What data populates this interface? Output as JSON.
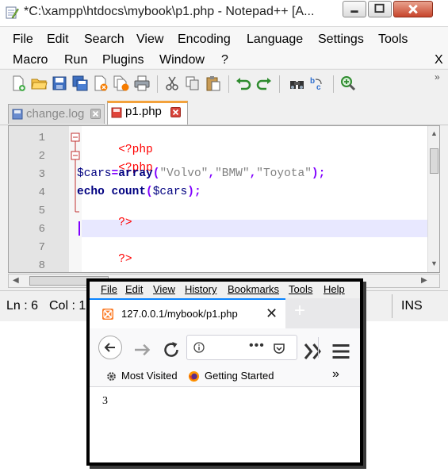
{
  "notepad": {
    "title": "*C:\\xampp\\htdocs\\mybook\\p1.php - Notepad++ [A...",
    "menu_row1": [
      "File",
      "Edit",
      "Search",
      "View",
      "Encoding",
      "Language",
      "Settings",
      "Tools"
    ],
    "menu_row2": [
      "Macro",
      "Run",
      "Plugins",
      "Window",
      "?"
    ],
    "menu_close": "X",
    "toolbar_overflow": "»",
    "tabs": [
      {
        "label": "change.log",
        "active": false
      },
      {
        "label": "p1.php",
        "active": true
      }
    ],
    "line_numbers": [
      "1",
      "2",
      "3",
      "4",
      "5",
      "6",
      "7",
      "8"
    ],
    "code": {
      "l1": "<?php",
      "l2": "<?php",
      "l3_var": "$cars",
      "l3_eq": "=",
      "l3_fn": "array",
      "l3_open": "(",
      "l3_s1": "\"Volvo\"",
      "l3_c1": ",",
      "l3_s2": "\"BMW\"",
      "l3_c2": ",",
      "l3_s3": "\"Toyota\"",
      "l3_close": ");",
      "l4_echo": "echo",
      "l4_count": "count",
      "l4_open": "(",
      "l4_var": "$cars",
      "l4_close": ");",
      "l5": "?>",
      "l7": "?>"
    },
    "status": {
      "ln": "Ln : 6",
      "col": "Col : 1",
      "mode": "INS"
    },
    "colors": {
      "keyword": "#000080",
      "tag": "#ff0000",
      "string": "#808080",
      "operator": "#8000ff",
      "current_line": "#e8e8ff"
    }
  },
  "firefox": {
    "menu": [
      "File",
      "Edit",
      "View",
      "History",
      "Bookmarks",
      "Tools",
      "Help"
    ],
    "tab_title": "127.0.0.1/mybook/p1.php",
    "tab_close": "✕",
    "new_tab": "+",
    "url_text": "",
    "url_dots": "•••",
    "bookmarks": [
      "Most Visited",
      "Getting Started"
    ],
    "bookmarks_overflow": "»",
    "page_output": "3",
    "accent_color": "#0a84ff"
  }
}
